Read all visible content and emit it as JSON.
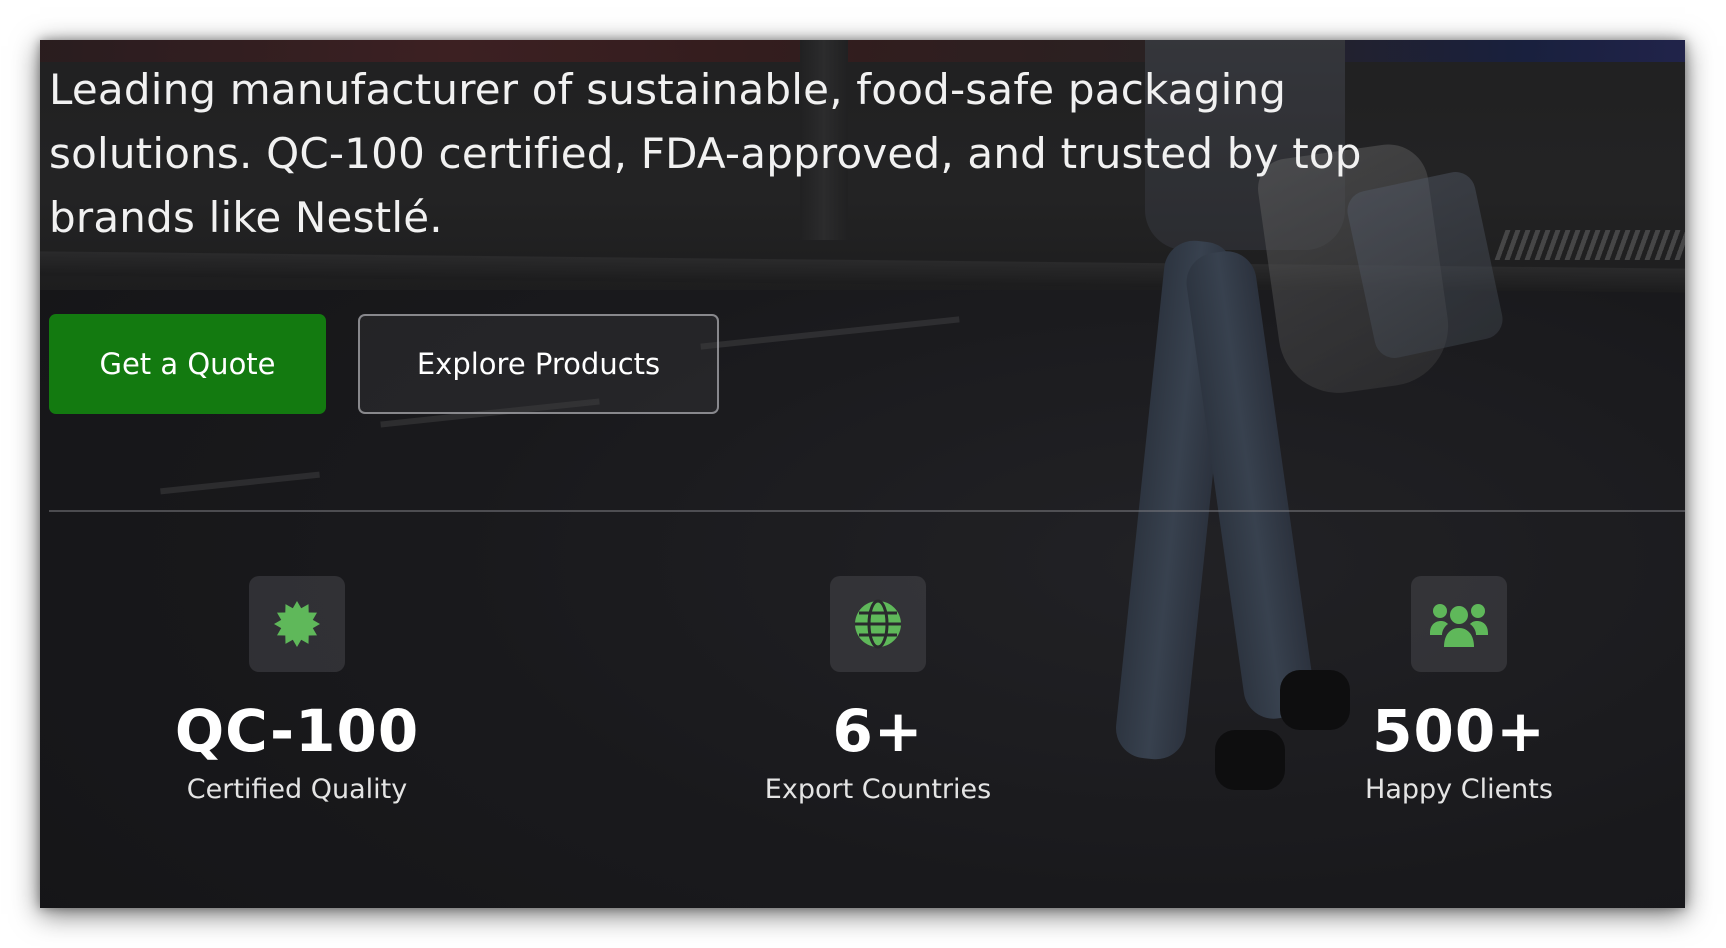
{
  "hero": {
    "tagline": "Leading manufacturer of sustainable, food-safe packaging solutions. QC-100 certified, FDA-approved, and trusted by top brands like Nestlé."
  },
  "actions": {
    "primary_label": "Get a Quote",
    "secondary_label": "Explore Products"
  },
  "stats": [
    {
      "icon": "certificate-badge-icon",
      "value": "QC-100",
      "label": "Certified Quality"
    },
    {
      "icon": "globe-icon",
      "value": "6+",
      "label": "Export Countries"
    },
    {
      "icon": "users-icon",
      "value": "500+",
      "label": "Happy Clients"
    }
  ],
  "colors": {
    "primary_button": "#137a10",
    "icon_accent": "#5fb85a",
    "text": "#ffffff"
  }
}
